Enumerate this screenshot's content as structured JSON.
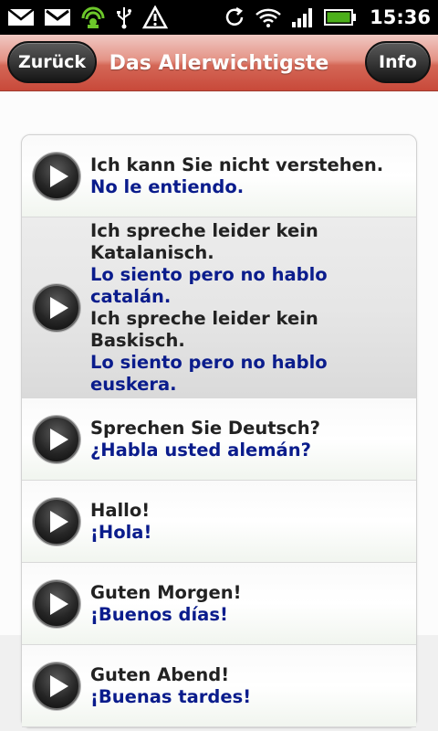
{
  "status_bar": {
    "time": "15:36",
    "icons_left": [
      "mail-icon",
      "gmail-icon",
      "android-icon",
      "usb-icon",
      "warning-icon"
    ],
    "icons_right": [
      "sync-icon",
      "wifi-icon",
      "signal-icon",
      "battery-icon"
    ]
  },
  "header": {
    "back_label": "Zurück",
    "title": "Das Allerwichtigste",
    "info_label": "Info"
  },
  "phrases": [
    {
      "lines": [
        {
          "lang": "de",
          "text": "Ich kann Sie nicht verstehen."
        },
        {
          "lang": "es",
          "text": "No le entiendo."
        }
      ]
    },
    {
      "highlighted": true,
      "lines": [
        {
          "lang": "de",
          "text": "Ich spreche leider kein Katalanisch."
        },
        {
          "lang": "es",
          "text": "Lo siento pero no hablo catalán."
        },
        {
          "lang": "de",
          "text": "Ich spreche leider kein Baskisch."
        },
        {
          "lang": "es",
          "text": "Lo siento pero no hablo euskera."
        }
      ]
    },
    {
      "lines": [
        {
          "lang": "de",
          "text": "Sprechen Sie Deutsch?"
        },
        {
          "lang": "es",
          "text": "¿Habla usted alemán?"
        }
      ]
    },
    {
      "lines": [
        {
          "lang": "de",
          "text": "Hallo!"
        },
        {
          "lang": "es",
          "text": "¡Hola!"
        }
      ]
    },
    {
      "lines": [
        {
          "lang": "de",
          "text": "Guten Morgen!"
        },
        {
          "lang": "es",
          "text": "¡Buenos días!"
        }
      ]
    },
    {
      "lines": [
        {
          "lang": "de",
          "text": "Guten Abend!"
        },
        {
          "lang": "es",
          "text": "¡Buenas tardes!"
        }
      ]
    }
  ],
  "colors": {
    "header_red": "#d46756",
    "spanish_text": "#0a1c8c",
    "german_text": "#222222",
    "battery_green": "#4caf1a",
    "android_green": "#6cc62a"
  }
}
